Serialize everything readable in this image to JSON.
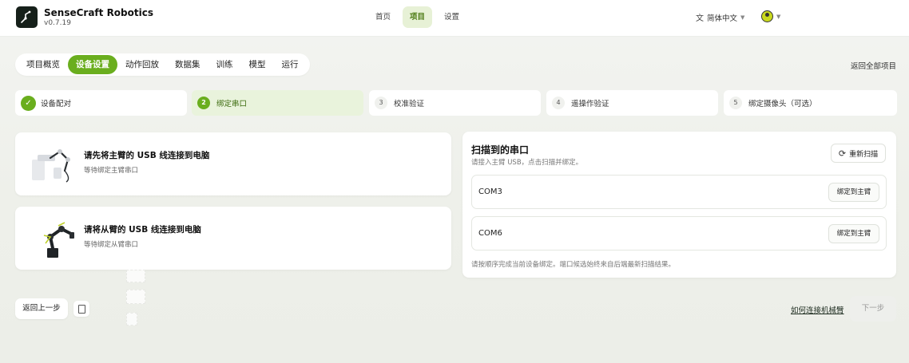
{
  "header": {
    "brand_name": "SenseCraft Robotics",
    "version": "v0.7.19",
    "nav": [
      {
        "label": "首页",
        "active": false
      },
      {
        "label": "项目",
        "active": true
      },
      {
        "label": "设置",
        "active": false
      }
    ],
    "language": "简体中文"
  },
  "subnav": {
    "tabs": [
      {
        "label": "项目概览",
        "active": false
      },
      {
        "label": "设备设置",
        "active": true
      },
      {
        "label": "动作回放",
        "active": false
      },
      {
        "label": "数据集",
        "active": false
      },
      {
        "label": "训练",
        "active": false
      },
      {
        "label": "模型",
        "active": false
      },
      {
        "label": "运行",
        "active": false
      }
    ],
    "back_all": "返回全部项目"
  },
  "steps": [
    {
      "num": "1",
      "label": "设备配对",
      "status": "done"
    },
    {
      "num": "2",
      "label": "绑定串口",
      "status": "current"
    },
    {
      "num": "3",
      "label": "校准验证",
      "status": "pending"
    },
    {
      "num": "4",
      "label": "遥操作验证",
      "status": "pending"
    },
    {
      "num": "5",
      "label": "绑定摄像头（可选）",
      "status": "pending"
    }
  ],
  "arms": [
    {
      "title": "请先将主臂的 USB 线连接到电脑",
      "subtitle": "等待绑定主臂串口"
    },
    {
      "title": "请将从臂的 USB 线连接到电脑",
      "subtitle": "等待绑定从臂串口"
    }
  ],
  "ports_panel": {
    "title": "扫描到的串口",
    "subtitle": "请接入主臂 USB，点击扫描并绑定。",
    "rescan_label": "重新扫描",
    "ports": [
      {
        "name": "COM3",
        "action": "绑定到主臂"
      },
      {
        "name": "COM6",
        "action": "绑定到主臂"
      }
    ],
    "note": "请按顺序完成当前设备绑定。端口候选始终来自后端最新扫描结果。"
  },
  "footer": {
    "prev_label": "返回上一步",
    "help_link": "如何连接机械臂",
    "next_label": "下一步"
  },
  "colors": {
    "accent": "#6aae1e",
    "accent_light": "#e9f3dc"
  }
}
